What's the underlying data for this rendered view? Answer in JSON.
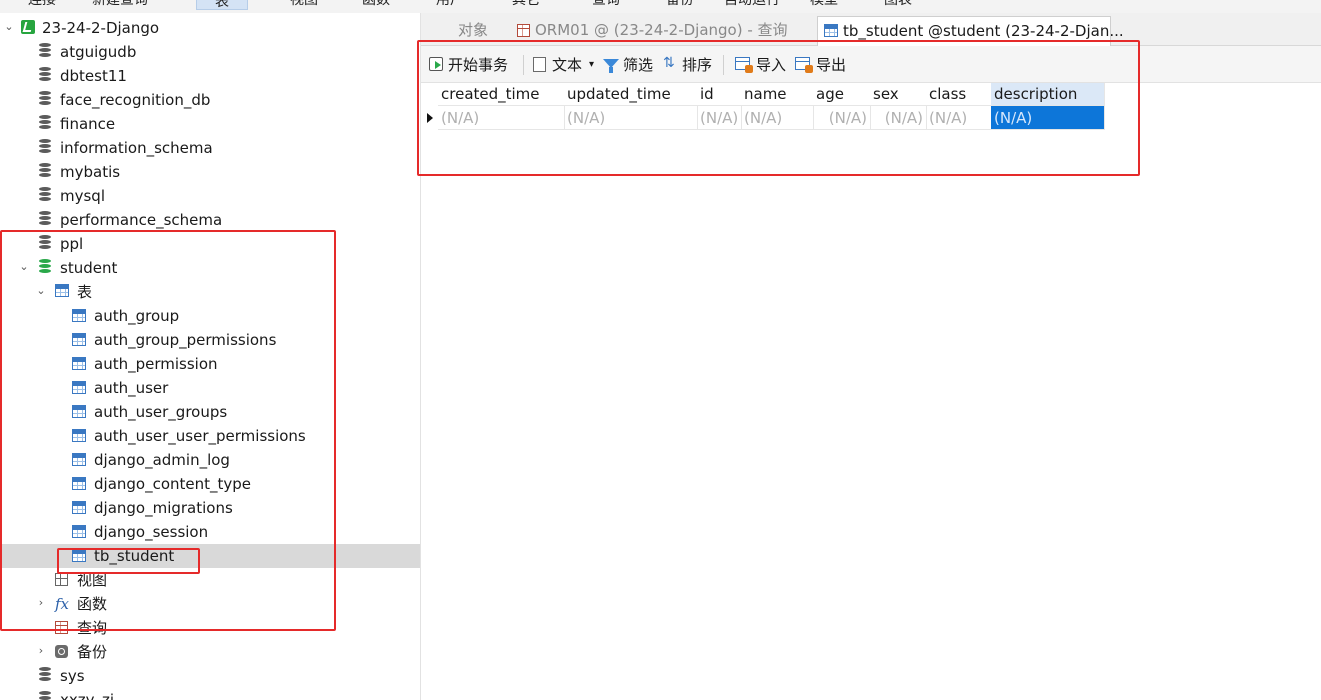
{
  "menubar": [
    "连接",
    "新建查询",
    "表",
    "视图",
    "函数",
    "用户",
    "其它",
    "查询",
    "备份",
    "自动运行",
    "模型",
    "图表"
  ],
  "tree": {
    "connection": "23-24-2-Django",
    "databases_top": [
      "atguigudb",
      "dbtest11",
      "face_recognition_db",
      "finance",
      "information_schema",
      "mybatis",
      "mysql",
      "performance_schema",
      "ppl"
    ],
    "open_db": "student",
    "tables_group": "表",
    "tables": [
      "auth_group",
      "auth_group_permissions",
      "auth_permission",
      "auth_user",
      "auth_user_groups",
      "auth_user_user_permissions",
      "django_admin_log",
      "django_content_type",
      "django_migrations",
      "django_session",
      "tb_student"
    ],
    "selected_table": "tb_student",
    "views_group": "视图",
    "functions_group": "函数",
    "queries_group": "查询",
    "backups_group": "备份",
    "databases_bottom": [
      "sys",
      "xxzy_zj"
    ]
  },
  "tabs": {
    "objects": "对象",
    "query_tab": "ORM01 @ (23-24-2-Django) - 查询",
    "table_tab": "tb_student @student (23-24-2-Djan..."
  },
  "toolbar": {
    "begin_tx": "开始事务",
    "text": "文本",
    "text_caret": "▾",
    "filter": "筛选",
    "sort": "排序",
    "import": "导入",
    "export": "导出"
  },
  "grid": {
    "columns": [
      "created_time",
      "updated_time",
      "id",
      "name",
      "age",
      "sex",
      "class",
      "description"
    ],
    "row": [
      "(N/A)",
      "(N/A)",
      "(N/A)",
      "(N/A)",
      "(N/A)",
      "(N/A)",
      "(N/A)",
      "(N/A)"
    ],
    "selected_column": "description"
  },
  "colors": {
    "highlight_box": "#e52a2a",
    "selected_cell": "#0d76d9",
    "db_open": "#2aa84a",
    "table_icon": "#3a78c2"
  }
}
